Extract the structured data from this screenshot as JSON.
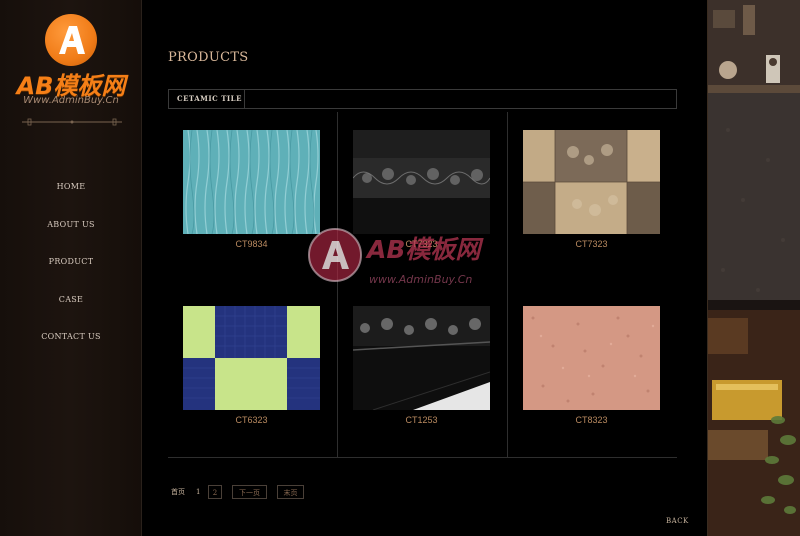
{
  "brand": {
    "logo_letter": "A",
    "logo_text": "AB模板网",
    "logo_sub": "Www.AdminBuy.Cn"
  },
  "nav": {
    "items": [
      {
        "label": "HOME"
      },
      {
        "label": "ABOUT US"
      },
      {
        "label": "PRODUCT"
      },
      {
        "label": "CASE"
      },
      {
        "label": "CONTACT US"
      }
    ]
  },
  "main": {
    "title": "PRODUCTS",
    "section_label": "CETAMIC TILE"
  },
  "products": [
    {
      "code": "CT9834",
      "pattern": "teal-wave"
    },
    {
      "code": "CT7323",
      "pattern": "black-floral-border"
    },
    {
      "code": "CT7323",
      "pattern": "beige-brown-patchwork"
    },
    {
      "code": "CT6323",
      "pattern": "blue-lime-checker"
    },
    {
      "code": "CT1253",
      "pattern": "black-marble-floral"
    },
    {
      "code": "CT8323",
      "pattern": "pink-granite"
    }
  ],
  "watermark": {
    "text": "AB模板网",
    "sub": "www.AdminBuy.Cn"
  },
  "pager": {
    "first": "首页",
    "current": "1",
    "page2": "2",
    "next": "下一页",
    "last": "末页"
  },
  "back_label": "BACK",
  "colors": {
    "accent_orange": "#f57f17",
    "title_tan": "#d9b89a",
    "code_text": "#b98a60"
  }
}
